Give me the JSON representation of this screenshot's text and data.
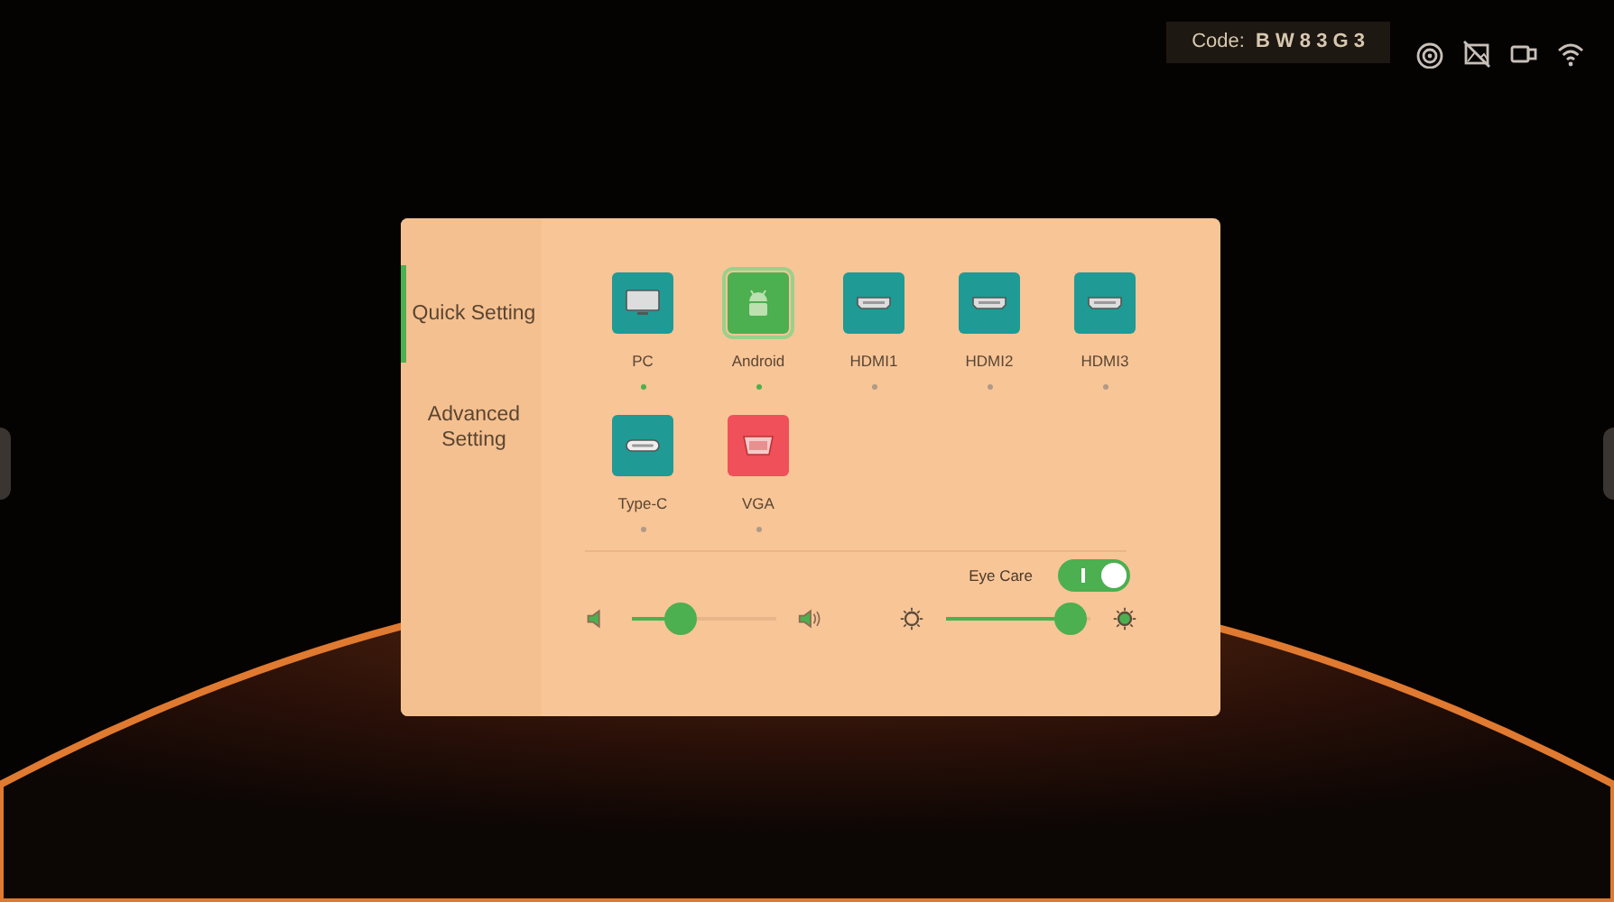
{
  "status_bar": {
    "code_label": "Code:",
    "code_value": "B W 8 3 G 3"
  },
  "sidebar": {
    "items": [
      {
        "label": "Quick Setting",
        "selected": true
      },
      {
        "label": "Advanced Setting",
        "selected": false
      }
    ]
  },
  "sources": [
    {
      "label": "PC",
      "kind": "monitor",
      "color": "#1f9a95",
      "selected": false,
      "signal": true
    },
    {
      "label": "Android",
      "kind": "android",
      "color": "#4caf50",
      "selected": true,
      "signal": true
    },
    {
      "label": "HDMI1",
      "kind": "hdmi",
      "color": "#1f9a95",
      "selected": false,
      "signal": false
    },
    {
      "label": "HDMI2",
      "kind": "hdmi",
      "color": "#1f9a95",
      "selected": false,
      "signal": false
    },
    {
      "label": "HDMI3",
      "kind": "hdmi",
      "color": "#1f9a95",
      "selected": false,
      "signal": false
    },
    {
      "label": "Type-C",
      "kind": "typec",
      "color": "#1f9a95",
      "selected": false,
      "signal": false
    },
    {
      "label": "VGA",
      "kind": "vga",
      "color": "#f0505a",
      "selected": false,
      "signal": false
    }
  ],
  "eye_care": {
    "label": "Eye Care",
    "on": true
  },
  "volume": {
    "level": 0.29
  },
  "brightness": {
    "level": 0.97
  }
}
